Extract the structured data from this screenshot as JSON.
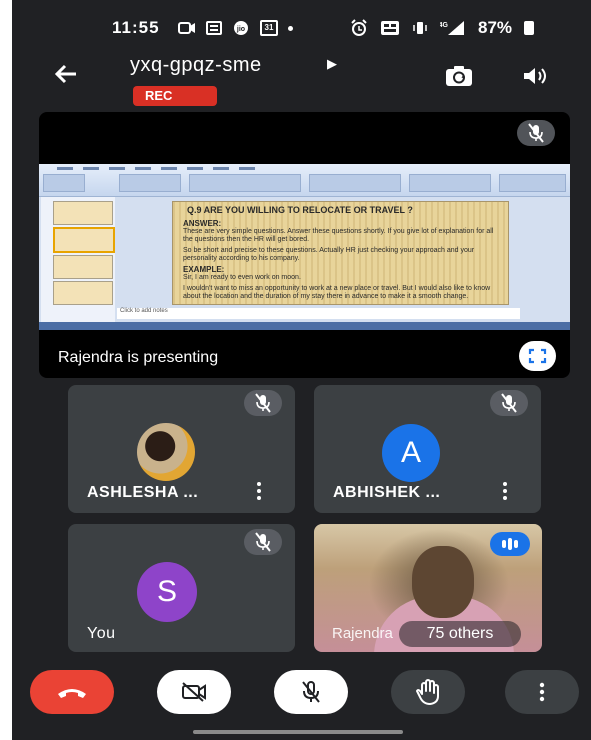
{
  "status_bar": {
    "time": "11:55",
    "calendar_day": "31",
    "network": "4G",
    "battery": "87%"
  },
  "header": {
    "meeting_code": "yxq-gpqz-sme",
    "rec_label": "REC"
  },
  "presentation": {
    "presenter_label": "Rajendra is presenting",
    "slide": {
      "title": "Q.9 ARE YOU WILLING TO RELOCATE OR TRAVEL ?",
      "answer_heading": "ANSWER:",
      "answer_lines": [
        "These are very simple questions. Answer these questions shortly. If you give lot of explanation for all the questions then the HR will get bored.",
        "So be short and precise to these questions. Actually HR just checking your approach and your personality according to his company."
      ],
      "example_heading": "EXAMPLE:",
      "example_lines": [
        "Sir, I am ready to even work on moon.",
        "I wouldn't want to miss an opportunity to work at a new place or travel. But I would also like to know about the location and the duration of my stay there in advance to make it a smooth change."
      ],
      "notes_placeholder": "Click to add notes"
    }
  },
  "participants": [
    {
      "name": "ASHLESHA ...",
      "mic_muted": true
    },
    {
      "name": "ABHISHEK ...",
      "avatar_letter": "A",
      "avatar_color": "#1a73e8",
      "mic_muted": true
    },
    {
      "name": "You",
      "avatar_letter": "S",
      "avatar_color": "#8e44c9",
      "mic_muted": true
    },
    {
      "name": "Rajendra",
      "speaking": true,
      "others_label": "75 others"
    }
  ],
  "colors": {
    "background": "#202124",
    "tile": "#3c4043",
    "rec": "#d93025",
    "hangup": "#ea4335"
  }
}
